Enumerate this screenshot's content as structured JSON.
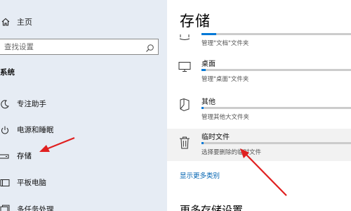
{
  "nav": {
    "home_label": "主页",
    "search_placeholder": "查找设置",
    "section_label": "系统",
    "items": [
      {
        "label": "专注助手",
        "icon": "moon-icon"
      },
      {
        "label": "电源和睡眠",
        "icon": "power-icon"
      },
      {
        "label": "存储",
        "icon": "storage-icon",
        "selected": true
      },
      {
        "label": "平板电脑",
        "icon": "tablet-icon"
      },
      {
        "label": "多任务处理",
        "icon": "multitask-icon"
      }
    ]
  },
  "content": {
    "title": "存储",
    "categories": [
      {
        "name": "",
        "desc": "管理\"文档\"文件夹",
        "usage": 0.1,
        "icon": "documents-icon"
      },
      {
        "name": "桌面",
        "desc": "管理\"桌面\"文件夹",
        "usage": 0.03,
        "icon": "desktop-icon"
      },
      {
        "name": "其他",
        "desc": "管理其他大文件夹",
        "usage": 0.01,
        "icon": "other-icon"
      },
      {
        "name": "临时文件",
        "desc": "选择要删除的临时文件",
        "usage": 0.01,
        "icon": "trash-icon",
        "highlighted": true
      }
    ],
    "show_more_link": "显示更多类别",
    "more_settings_title": "更多存储设置"
  },
  "colors": {
    "accent": "#0078d7",
    "nav_background": "#e6ecf4",
    "annotation_arrow": "#e02020"
  }
}
